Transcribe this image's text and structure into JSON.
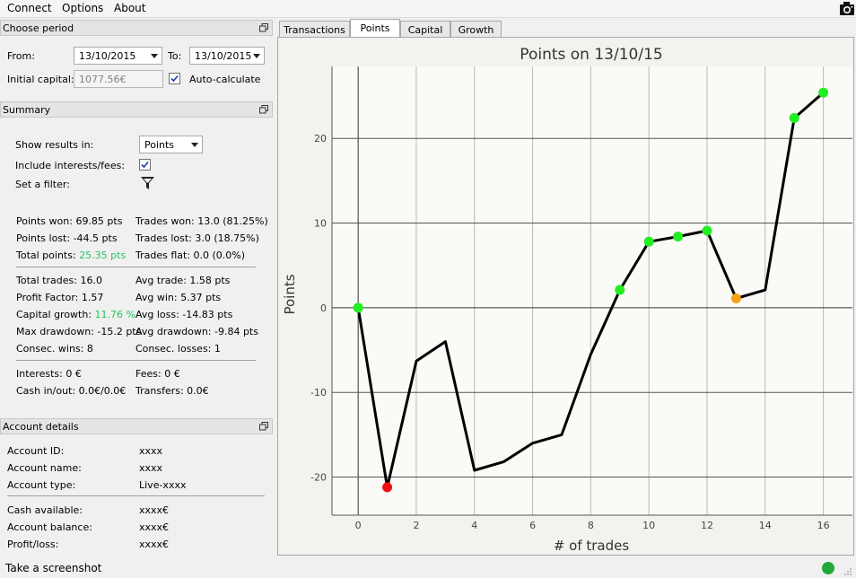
{
  "menu": {
    "connect": "Connect",
    "options": "Options",
    "about": "About"
  },
  "period": {
    "header": "Choose period",
    "from_label": "From:",
    "from_value": "13/10/2015",
    "to_label": "To:",
    "to_value": "13/10/2015",
    "capital_label": "Initial capital:",
    "capital_value": "1077.56€",
    "auto_label": "Auto-calculate"
  },
  "summary": {
    "header": "Summary",
    "show_results_label": "Show results in:",
    "show_results_value": "Points",
    "include_label": "Include interests/fees:",
    "filter_label": "Set a filter:",
    "points_won": "Points won: 69.85 pts",
    "points_lost": "Points lost: -44.5 pts",
    "total_points_label": "Total points:",
    "total_points_value": "25.35 pts",
    "trades_won": "Trades won: 13.0 (81.25%)",
    "trades_lost": "Trades lost: 3.0 (18.75%)",
    "trades_flat": "Trades flat: 0.0 (0.0%)",
    "total_trades": "Total trades: 16.0",
    "profit_factor": "Profit Factor: 1.57",
    "capital_growth_label": "Capital growth:",
    "capital_growth_value": "11.76 %",
    "max_drawdown": "Max drawdown: -15.2 pts",
    "consec_wins": "Consec. wins: 8",
    "avg_trade": "Avg trade: 1.58 pts",
    "avg_win": "Avg win: 5.37 pts",
    "avg_loss": "Avg loss: -14.83 pts",
    "avg_drawdown": "Avg drawdown: -9.84 pts",
    "consec_losses": "Consec. losses: 1",
    "interests": "Interests: 0 €",
    "cash_inout": "Cash in/out: 0.0€/0.0€",
    "fees": "Fees: 0 €",
    "transfers": "Transfers: 0.0€"
  },
  "account": {
    "header": "Account details",
    "id_label": "Account ID:",
    "id_value": "xxxx",
    "name_label": "Account name:",
    "name_value": "xxxx",
    "type_label": "Account type:",
    "type_value": "Live-xxxx",
    "cash_label": "Cash available:",
    "cash_value": "xxxx€",
    "balance_label": "Account balance:",
    "balance_value": "xxxx€",
    "pl_label": "Profit/loss:",
    "pl_value": "xxxx€"
  },
  "tabs": [
    "Transactions",
    "Points",
    "Capital",
    "Growth"
  ],
  "status": {
    "text": "Take a screenshot"
  },
  "colors": {
    "win": "#22ee22",
    "loss": "#ee1111",
    "flat": "#f5a214",
    "line": "#000000",
    "positive_text": "#22c55e",
    "status_ok": "#22a83a"
  },
  "chart_data": {
    "type": "line",
    "title": "Points on 13/10/15",
    "xlabel": "# of trades",
    "ylabel": "Points",
    "xlim": [
      -0.9,
      17
    ],
    "ylim": [
      -24.5,
      28.5
    ],
    "xticks": [
      0,
      2,
      4,
      6,
      8,
      10,
      12,
      14,
      16
    ],
    "yticks": [
      -20,
      -10,
      0,
      10,
      20
    ],
    "grid": true,
    "x": [
      0,
      1,
      2,
      3,
      4,
      5,
      6,
      7,
      8,
      9,
      10,
      11,
      12,
      13,
      14,
      15,
      16
    ],
    "y": [
      0,
      -21.2,
      -6.3,
      -4,
      -19.2,
      -18.2,
      -16,
      -15,
      -5.5,
      2.1,
      7.8,
      8.4,
      9.1,
      1.1,
      2.1,
      22.4,
      25.4
    ],
    "markers": [
      {
        "x": 0,
        "status": "win"
      },
      {
        "x": 1,
        "status": "loss"
      },
      {
        "x": 9,
        "status": "win"
      },
      {
        "x": 10,
        "status": "win"
      },
      {
        "x": 11,
        "status": "win"
      },
      {
        "x": 12,
        "status": "win"
      },
      {
        "x": 13,
        "status": "flat"
      },
      {
        "x": 15,
        "status": "win"
      },
      {
        "x": 16,
        "status": "win"
      }
    ]
  }
}
